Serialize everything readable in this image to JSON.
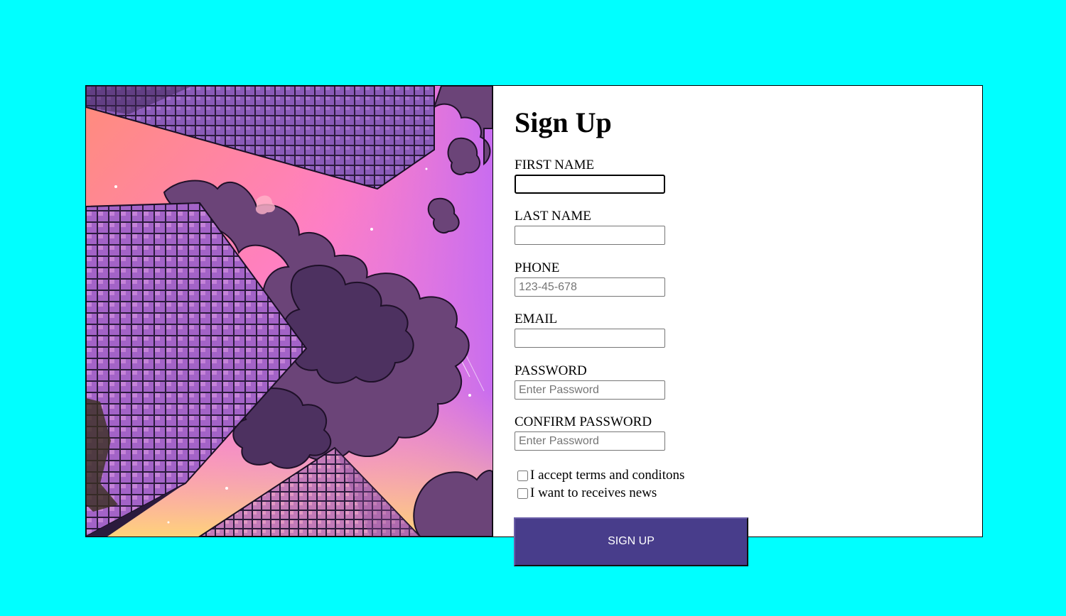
{
  "form": {
    "title": "Sign Up",
    "fields": [
      {
        "label": "FIRST NAME",
        "value": "",
        "placeholder": ""
      },
      {
        "label": "LAST NAME",
        "value": "",
        "placeholder": ""
      },
      {
        "label": "PHONE",
        "value": "",
        "placeholder": "123-45-678"
      },
      {
        "label": "EMAIL",
        "value": "",
        "placeholder": ""
      },
      {
        "label": "PASSWORD",
        "value": "",
        "placeholder": "Enter Password"
      },
      {
        "label": "CONFIRM PASSWORD",
        "value": "",
        "placeholder": "Enter Password"
      }
    ],
    "checkboxes": [
      {
        "label": "I accept terms and conditons",
        "checked": false
      },
      {
        "label": "I want to receives news",
        "checked": false
      }
    ],
    "submit_label": "SIGN UP"
  },
  "colors": {
    "page_background": "#00ffff",
    "button_background": "#483d8b",
    "sky_top": "#ff8c7a",
    "sky_mid": "#ff7fc4",
    "sky_right": "#c86cf0",
    "sky_bottom": "#ffd27a",
    "building": "#5e3f86",
    "cloud": "#6b4478"
  },
  "image": {
    "icon": "city-skyline-illustration"
  }
}
